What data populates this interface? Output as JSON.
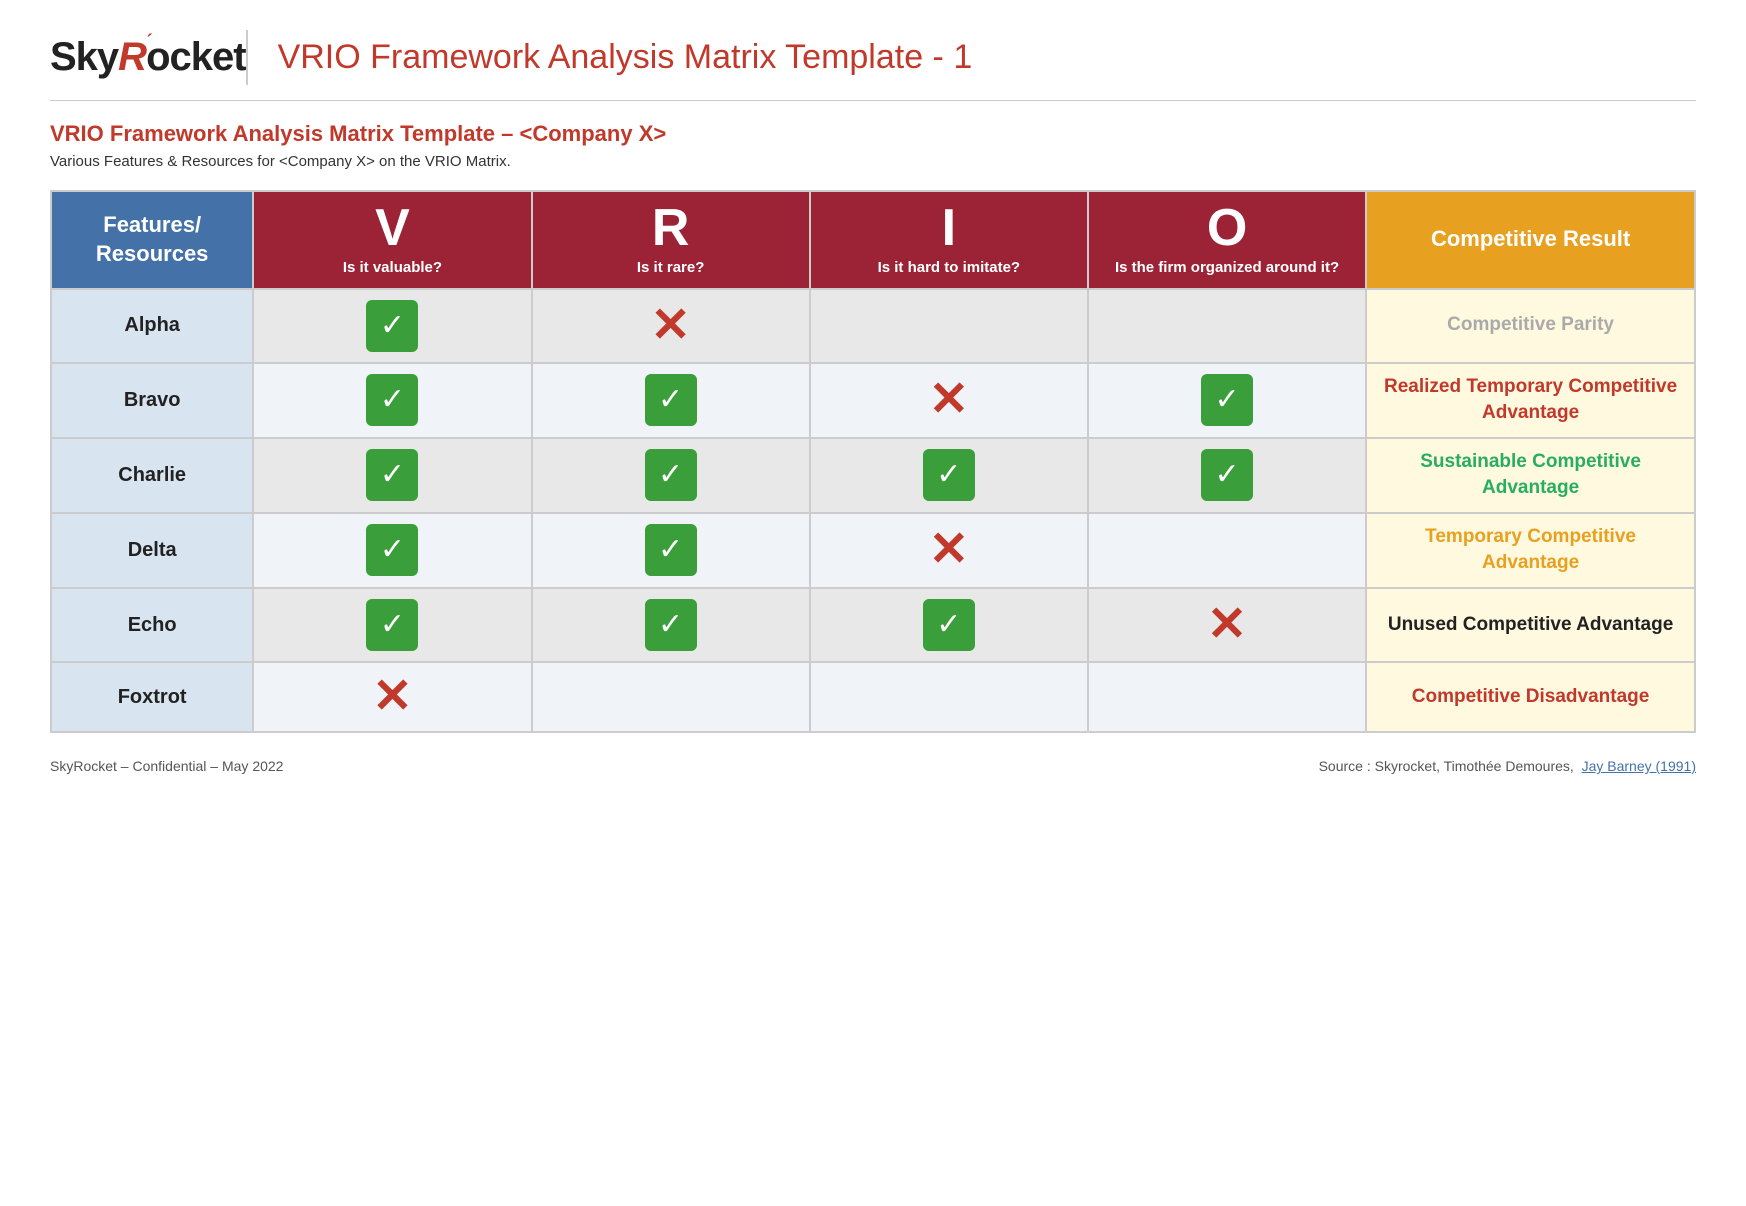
{
  "header": {
    "logo_sky": "Sky",
    "logo_R": "R",
    "logo_ocket": "ocket",
    "title": "VRIO Framework Analysis Matrix Template - 1"
  },
  "subheading": {
    "h2": "VRIO Framework Analysis Matrix Template – <Company X>",
    "p": "Various Features & Resources for <Company X> on the VRIO Matrix."
  },
  "table": {
    "headers": {
      "features": "Features/ Resources",
      "V_letter": "V",
      "V_sub": "Is it valuable?",
      "R_letter": "R",
      "R_sub": "Is it rare?",
      "I_letter": "I",
      "I_sub": "Is it hard to imitate?",
      "O_letter": "O",
      "O_sub": "Is the firm organized around it?",
      "result": "Competitive Result"
    },
    "rows": [
      {
        "label": "Alpha",
        "V": "check",
        "R": "cross",
        "I": "",
        "O": "",
        "result": "Competitive Parity",
        "result_class": "result-parity"
      },
      {
        "label": "Bravo",
        "V": "check",
        "R": "check",
        "I": "cross",
        "O": "check",
        "result": "Realized Temporary Competitive Advantage",
        "result_class": "result-realized"
      },
      {
        "label": "Charlie",
        "V": "check",
        "R": "check",
        "I": "check",
        "O": "check",
        "result": "Sustainable Competitive Advantage",
        "result_class": "result-sustainable"
      },
      {
        "label": "Delta",
        "V": "check",
        "R": "check",
        "I": "cross",
        "O": "",
        "result": "Temporary Competitive Advantage",
        "result_class": "result-temporary"
      },
      {
        "label": "Echo",
        "V": "check",
        "R": "check",
        "I": "check",
        "O": "cross",
        "result": "Unused Competitive Advantage",
        "result_class": "result-unused"
      },
      {
        "label": "Foxtrot",
        "V": "cross",
        "R": "",
        "I": "",
        "O": "",
        "result": "Competitive Disadvantage",
        "result_class": "result-disadvantage"
      }
    ]
  },
  "footer": {
    "left": "SkyRocket – Confidential – May 2022",
    "right_text": "Source : Skyrocket, Timothée Demoures,",
    "right_link": "Jay Barney (1991)"
  }
}
